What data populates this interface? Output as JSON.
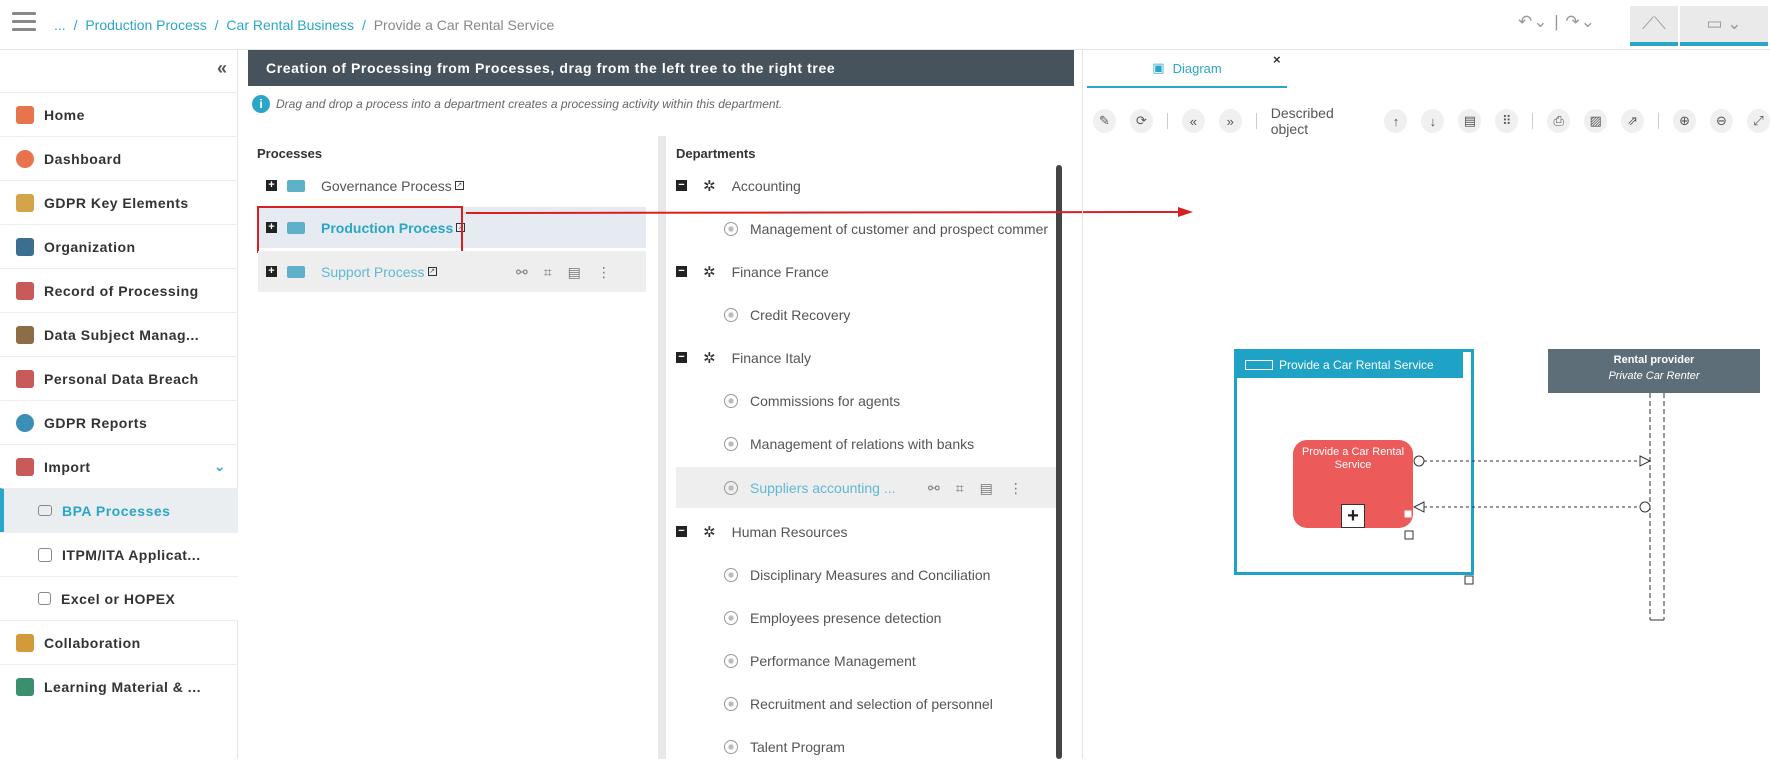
{
  "breadcrumb": {
    "ellipsis": "...",
    "link1": "Production Process",
    "link2": "Car Rental Business",
    "current": "Provide a Car Rental Service",
    "sep": "/"
  },
  "sidebar": {
    "items": [
      {
        "label": "Home",
        "color": "#e8744d"
      },
      {
        "label": "Dashboard",
        "color": "#e8744d"
      },
      {
        "label": "GDPR Key Elements",
        "color": "#d3a44a"
      },
      {
        "label": "Organization",
        "color": "#3b6e8f"
      },
      {
        "label": "Record of Processing",
        "color": "#c95a5a"
      },
      {
        "label": "Data Subject Manag...",
        "color": "#8c6d46"
      },
      {
        "label": "Personal Data Breach",
        "color": "#c95a5a"
      },
      {
        "label": "GDPR Reports",
        "color": "#3b8fb5"
      },
      {
        "label": "Import",
        "color": "#c95a5a"
      },
      {
        "label": "BPA Processes",
        "color": "#888888"
      },
      {
        "label": "ITPM/ITA Applicat...",
        "color": "#888888"
      },
      {
        "label": "Excel or HOPEX",
        "color": "#888888"
      },
      {
        "label": "Collaboration",
        "color": "#d39a3a"
      },
      {
        "label": "Learning Material & ...",
        "color": "#3b8f6e"
      }
    ]
  },
  "mid": {
    "header": "Creation of Processing from Processes, drag from the left tree to the right tree",
    "info": "Drag and drop a process into a department creates a processing activity within this department.",
    "processes_title": "Processes",
    "departments_title": "Departments",
    "processes": [
      "Governance Process",
      "Production Process",
      "Support Process"
    ],
    "departments": [
      {
        "label": "Accounting",
        "type": "dept"
      },
      {
        "label": "Management of customer and prospect commer",
        "type": "act"
      },
      {
        "label": "Finance France",
        "type": "dept"
      },
      {
        "label": "Credit Recovery",
        "type": "act"
      },
      {
        "label": "Finance Italy",
        "type": "dept"
      },
      {
        "label": "Commissions for agents",
        "type": "act"
      },
      {
        "label": "Management of relations with banks",
        "type": "act"
      },
      {
        "label": "Suppliers accounting ...",
        "type": "act"
      },
      {
        "label": "Human Resources",
        "type": "dept"
      },
      {
        "label": "Disciplinary Measures and Conciliation",
        "type": "act"
      },
      {
        "label": "Employees presence detection",
        "type": "act"
      },
      {
        "label": "Performance Management",
        "type": "act"
      },
      {
        "label": "Recruitment and selection of personnel",
        "type": "act"
      },
      {
        "label": "Talent Program",
        "type": "act"
      }
    ]
  },
  "diagram": {
    "tab_label": "Diagram",
    "close": "×",
    "described_object": "Described object",
    "pool_title": "Provide a Car Rental Service",
    "task_label": "Provide a Car Rental Service",
    "rental_title": "Rental provider",
    "rental_sub": "Private Car Renter"
  },
  "colors": {
    "accent": "#2aa6c8",
    "header": "#46535d",
    "task": "#ec5a5a",
    "annotation": "#d91f1f"
  }
}
